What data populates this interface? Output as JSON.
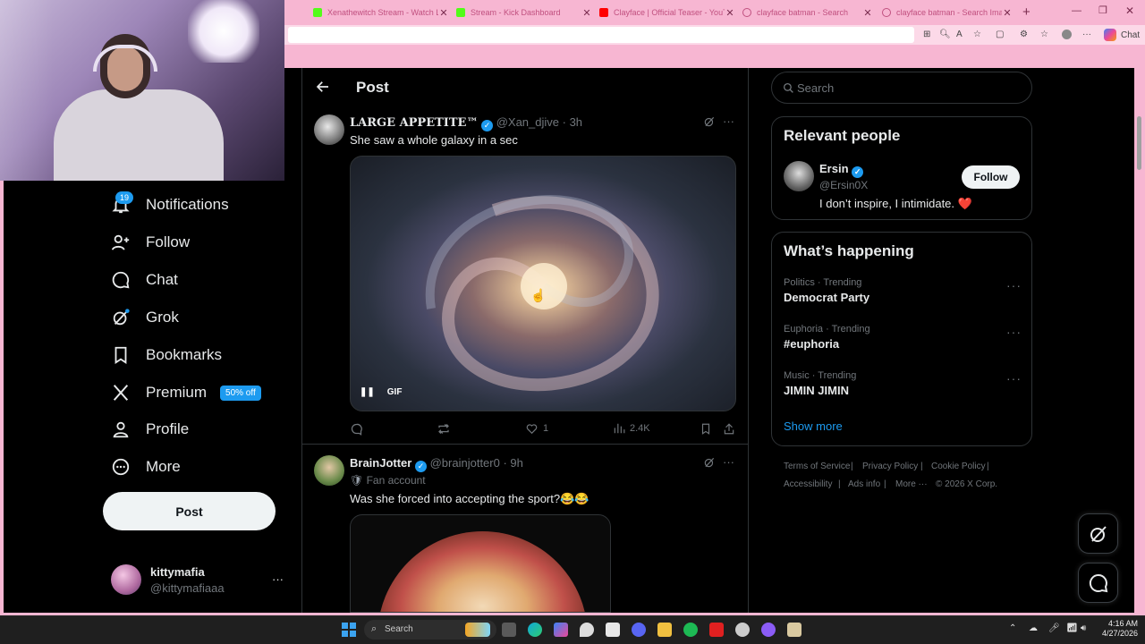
{
  "browser": {
    "tabs": [
      {
        "label": "Xenathewitch Stream - Watch Live",
        "color": "#53fc18"
      },
      {
        "label": "Stream - Kick Dashboard",
        "color": "#53fc18"
      },
      {
        "label": "Clayface | Official Teaser - YouTube",
        "color": "#ff0000"
      },
      {
        "label": "clayface batman - Search",
        "color": "#f7b6d2"
      },
      {
        "label": "clayface batman - Search Images",
        "color": "#f7b6d2"
      }
    ],
    "chat_label": "Chat"
  },
  "sidebar": {
    "notifications_badge": "19",
    "items": [
      {
        "label": "Notifications",
        "icon": "bell-icon"
      },
      {
        "label": "Follow",
        "icon": "add-person-icon"
      },
      {
        "label": "Chat",
        "icon": "chat-bubble-icon"
      },
      {
        "label": "Grok",
        "icon": "grok-icon"
      },
      {
        "label": "Bookmarks",
        "icon": "bookmark-icon"
      },
      {
        "label": "Premium",
        "icon": "x-logo-icon"
      },
      {
        "label": "Profile",
        "icon": "person-icon"
      },
      {
        "label": "More",
        "icon": "more-circle-icon"
      }
    ],
    "premium_badge": "50% off",
    "post_button": "Post",
    "account": {
      "name": "kittymafia",
      "handle": "@kittymafiaaa"
    }
  },
  "main": {
    "header_title": "Post",
    "post1": {
      "author": "LARGE APPETITE™",
      "handle": "@Xan_djive",
      "time": "· 3h",
      "text": "She saw a whole galaxy in a sec",
      "media_badge": "GIF",
      "likes": "1",
      "views": "2.4K"
    },
    "post2": {
      "author": "BrainJotter",
      "handle": "@brainjotter0",
      "time": "· 9h",
      "label": "Fan account",
      "text": "Was she forced into accepting the sport?😂😂"
    }
  },
  "right": {
    "search_placeholder": "Search",
    "relevant_title": "Relevant people",
    "person": {
      "name": "Ersin",
      "handle": "@Ersin0X",
      "bio": "I don’t inspire, I intimidate. ❤️",
      "follow_label": "Follow"
    },
    "happening_title": "What’s happening",
    "trends": [
      {
        "category": "Politics · Trending",
        "name": "Democrat Party"
      },
      {
        "category": "Euphoria · Trending",
        "name": "#euphoria"
      },
      {
        "category": "Music · Trending",
        "name": "JIMIN JIMIN"
      }
    ],
    "show_more": "Show more",
    "footer": {
      "terms": "Terms of Service",
      "privacy": "Privacy Policy",
      "cookie": "Cookie Policy",
      "accessibility": "Accessibility",
      "ads": "Ads info",
      "more": "More ···",
      "copyright": "© 2026 X Corp."
    }
  },
  "taskbar": {
    "search_label": "Search",
    "time": "4:16 AM",
    "date": "4/27/2026"
  }
}
